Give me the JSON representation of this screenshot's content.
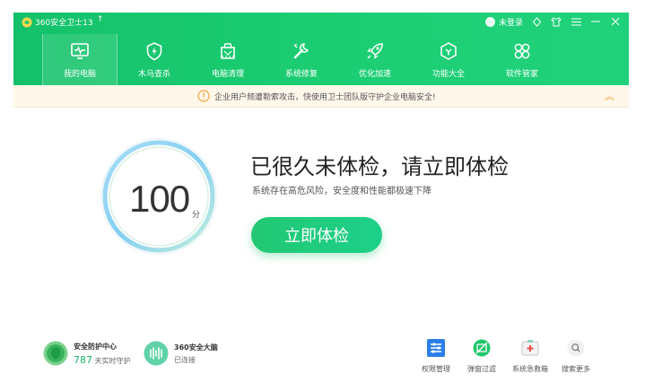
{
  "app": {
    "title": "360安全卫士13",
    "upgrade_icon": "arrow-up-icon",
    "user_label": "未登录"
  },
  "window_controls": [
    "skin-icon",
    "shirt-icon",
    "menu-icon",
    "minimize-icon",
    "close-icon"
  ],
  "nav": {
    "items": [
      {
        "label": "我的电脑",
        "icon": "monitor-icon",
        "active": true
      },
      {
        "label": "木马查杀",
        "icon": "shield-bolt-icon"
      },
      {
        "label": "电脑清理",
        "icon": "broom-icon"
      },
      {
        "label": "系统修复",
        "icon": "wrench-icon"
      },
      {
        "label": "优化加速",
        "icon": "rocket-icon"
      },
      {
        "label": "功能大全",
        "icon": "apps-icon"
      },
      {
        "label": "软件管家",
        "icon": "clover-icon"
      }
    ]
  },
  "notice": {
    "text": "企业用户频遭勒索攻击，快使用卫士团队版守护企业电脑安全!",
    "icon": "alert-icon",
    "accent": "#f0a23a"
  },
  "main": {
    "score": "100",
    "score_unit": "分",
    "headline": "已很久未体检，请立即体检",
    "subline": "系统存在高危风险，安全度和性能都极速下降",
    "check_button": "立即体检"
  },
  "status": {
    "protection_title": "安全防护中心",
    "protection_count": "787",
    "protection_suffix": "天实时守护",
    "brain_title": "360安全大脑",
    "brain_status": "已连接"
  },
  "tools": [
    {
      "label": "权限管理",
      "icon": "permissions-icon"
    },
    {
      "label": "弹窗过滤",
      "icon": "popup-filter-icon"
    },
    {
      "label": "系统急救箱",
      "icon": "first-aid-icon"
    },
    {
      "label": "搜索更多",
      "icon": "search-icon"
    }
  ],
  "colors": {
    "brand_green": "#1cc96f",
    "notice_bg": "#fff8ea",
    "ring_blue": "#6ec6f0"
  }
}
